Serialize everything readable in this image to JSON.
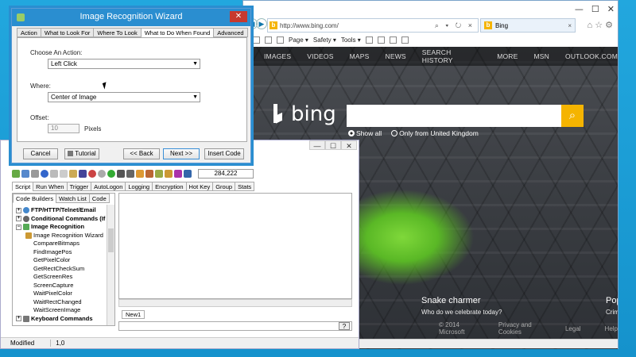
{
  "ie": {
    "url": "http://www.bing.com/",
    "url_tools": "⌕ ▾ ↻ ×",
    "tab_title": "Bing",
    "win_min": "—",
    "win_max": "☐",
    "win_close": "✕",
    "right_icons": "⌂ ☆ ⚙",
    "cmdbar": {
      "page": "Page ▾",
      "safety": "Safety ▾",
      "tools": "Tools ▾"
    },
    "bing": {
      "nav": [
        "IMAGES",
        "VIDEOS",
        "MAPS",
        "NEWS",
        "SEARCH HISTORY",
        "MORE",
        "MSN",
        "OUTLOOK.COM"
      ],
      "logo_text": "bing",
      "radio_show_all": "Show all",
      "radio_only_uk": "Only from United Kingdom",
      "caption_title": "Snake charmer",
      "caption_sub": "Who do we celebrate today?",
      "caption2_title": "Pop",
      "caption2_sub": "Crim",
      "footer": [
        "© 2014 Microsoft",
        "Privacy and Cookies",
        "Legal",
        "Help"
      ]
    }
  },
  "automate": {
    "toolbar_coord": "284,222",
    "tabs": [
      "Script",
      "Run When",
      "Trigger",
      "AutoLogon",
      "Logging",
      "Encryption",
      "Hot Key",
      "Group",
      "Stats"
    ],
    "left_tabs": [
      "Code Builders",
      "Watch List",
      "Code"
    ],
    "tree": {
      "top": [
        {
          "label": "FTP/HTTP/Telnet/Email",
          "exp": "+"
        },
        {
          "label": "Conditional Commands (If",
          "exp": "+"
        },
        {
          "label": "Image Recognition",
          "exp": "−"
        }
      ],
      "sub": [
        "Image Recognition Wizard",
        "CompareBitmaps",
        "FindImagePos",
        "GetPixelColor",
        "GetRectCheckSum",
        "GetScreenRes",
        "ScreenCapture",
        "WaitPixelColor",
        "WaitRectChanged",
        "WaitScreenImage"
      ],
      "bottom": {
        "label": "Keyboard Commands",
        "exp": "+"
      }
    },
    "editor_tab": "New1",
    "cmd_help": "?",
    "status_left": "Modified",
    "status_pos": "1,0"
  },
  "wizard": {
    "title": "Image Recognition Wizard",
    "close": "✕",
    "tabs": [
      "Action",
      "What to Look For",
      "Where To Look",
      "What to Do When Found",
      "Advanced"
    ],
    "active_tab": 3,
    "choose_action_label": "Choose An Action:",
    "choose_action_value": "Left Click",
    "where_label": "Where:",
    "where_value": "Center of Image",
    "offset_label": "Offset:",
    "offset_value": "10",
    "offset_unit": "Pixels",
    "buttons": {
      "cancel": "Cancel",
      "tutorial": "Tutorial",
      "back": "<< Back",
      "next": "Next >>",
      "insert": "Insert Code"
    }
  }
}
